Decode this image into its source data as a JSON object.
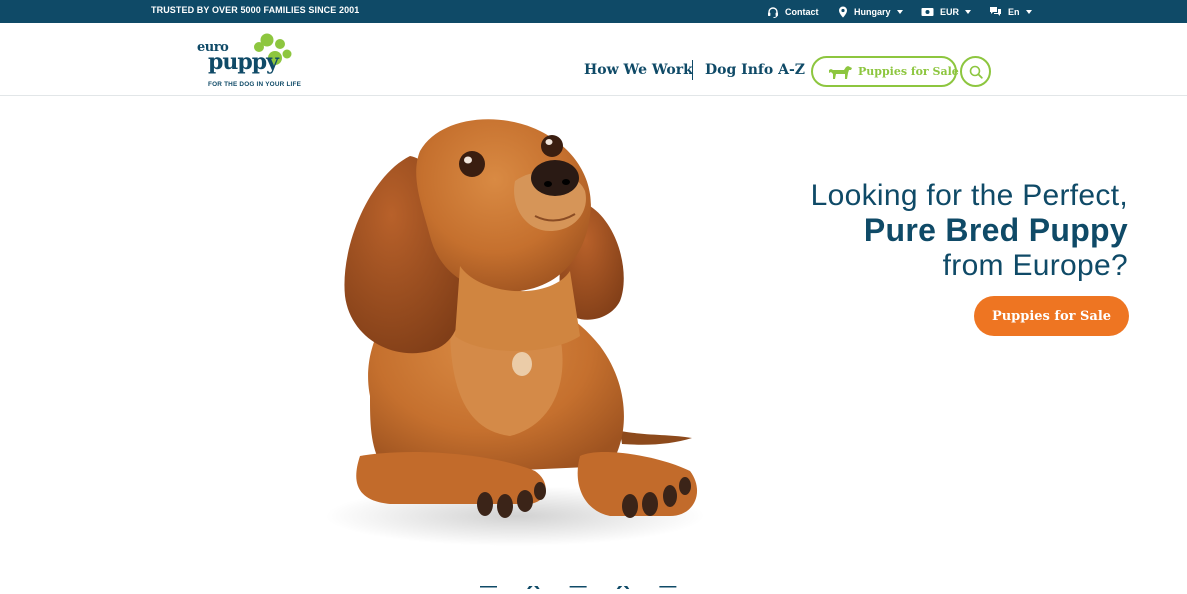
{
  "topbar": {
    "trusted": "TRUSTED BY OVER 5000 FAMILIES SINCE 2001",
    "contact": "Contact",
    "country": "Hungary",
    "currency": "EUR",
    "language": "En"
  },
  "logo": {
    "euro": "euro",
    "puppy": "puppy",
    "tagline": "FOR THE DOG IN YOUR LIFE"
  },
  "nav": {
    "how_we_work": "How We Work",
    "dog_info": "Dog Info A-Z",
    "puppies_for_sale": "Puppies for Sale"
  },
  "hero": {
    "line1": "Looking for the Perfect,",
    "line2": "Pure Bred Puppy",
    "line3": "from Europe?",
    "cta": "Puppies for Sale"
  },
  "colors": {
    "navy": "#0f4a67",
    "green": "#8dc63f",
    "orange": "#ee7522"
  }
}
